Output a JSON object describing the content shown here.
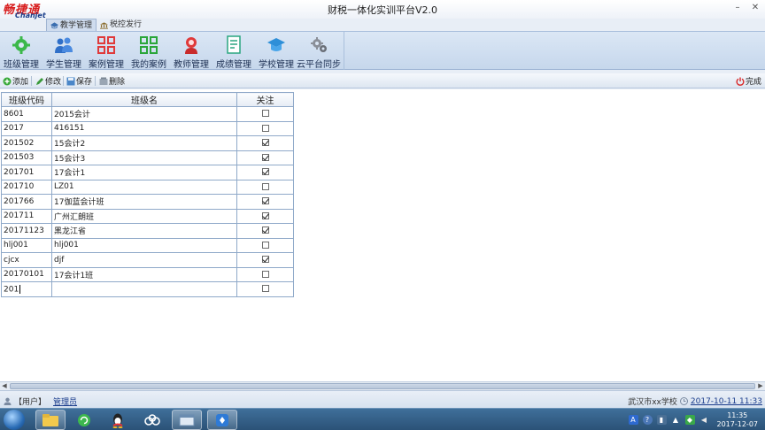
{
  "window": {
    "logo_cn": "畅捷通",
    "logo_en": "Chanjet",
    "title": "财税一体化实训平台V2.0",
    "minimize": "–",
    "close": "✕"
  },
  "top_tabs": [
    {
      "label": "教学管理",
      "active": true
    },
    {
      "label": "税控发行",
      "active": false
    }
  ],
  "ribbon": [
    {
      "label": "班级管理",
      "icon": "gear-icon"
    },
    {
      "label": "学生管理",
      "icon": "users-icon"
    },
    {
      "label": "案例管理",
      "icon": "grid-icon"
    },
    {
      "label": "我的案例",
      "icon": "grid-icon"
    },
    {
      "label": "教师管理",
      "icon": "teacher-icon"
    },
    {
      "label": "成绩管理",
      "icon": "report-icon"
    },
    {
      "label": "学校管理",
      "icon": "school-icon"
    },
    {
      "label": "云平台同步",
      "icon": "cloud-gear-icon"
    }
  ],
  "toolbar": {
    "add": "添加",
    "edit": "修改",
    "save": "保存",
    "delete": "删除",
    "done": "完成"
  },
  "table": {
    "headers": [
      "班级代码",
      "班级名",
      "关注"
    ],
    "rows": [
      {
        "code": "8601",
        "name": "2015会计",
        "follow": false
      },
      {
        "code": "2017",
        "name": "416151",
        "follow": false
      },
      {
        "code": "201502",
        "name": "15会计2",
        "follow": true
      },
      {
        "code": "201503",
        "name": "15会计3",
        "follow": true
      },
      {
        "code": "201701",
        "name": "17会计1",
        "follow": true
      },
      {
        "code": "201710",
        "name": "LZ01",
        "follow": false
      },
      {
        "code": "201766",
        "name": "17伽蓝会计班",
        "follow": true
      },
      {
        "code": "201711",
        "name": "广州汇朗班",
        "follow": true
      },
      {
        "code": "20171123",
        "name": "黑龙江省",
        "follow": true
      },
      {
        "code": "hlj001",
        "name": "hlj001",
        "follow": false
      },
      {
        "code": "cjcx",
        "name": "djf",
        "follow": true
      },
      {
        "code": "20170101",
        "name": "17会计1班",
        "follow": false
      },
      {
        "code": "201",
        "name": "",
        "follow": false,
        "editing": true
      }
    ]
  },
  "status": {
    "user_label": "【用户】",
    "user_name": "管理员",
    "school": "武汉市xx学校",
    "datetime": "2017-10-11 11:33"
  },
  "taskbar": {
    "time": "11:35",
    "date": "2017-12-07",
    "apps": [
      "explorer-icon",
      "refresh-app-icon",
      "qq-icon",
      "cloud-app-icon",
      "window-app-icon",
      "app-icon"
    ]
  },
  "colors": {
    "accent_red": "#d81e1e",
    "ribbon_bg": "#c6d7ec",
    "grid_border": "#8fa9c9",
    "link_blue": "#1a3c8c"
  }
}
